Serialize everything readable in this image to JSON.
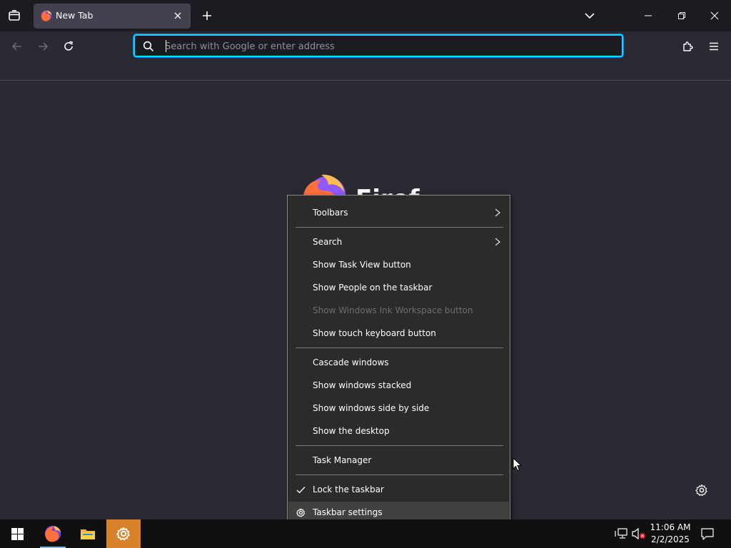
{
  "browser": {
    "tab": {
      "title": "New Tab"
    },
    "urlbar": {
      "placeholder": "Search with Google or enter address"
    },
    "content": {
      "wordmark": "Firef"
    }
  },
  "context_menu": {
    "items": [
      {
        "label": "Toolbars",
        "submenu": true,
        "disabled": false
      },
      {
        "label": "Search",
        "submenu": true,
        "disabled": false
      },
      {
        "label": "Show Task View button",
        "disabled": false
      },
      {
        "label": "Show People on the taskbar",
        "disabled": false
      },
      {
        "label": "Show Windows Ink Workspace button",
        "disabled": true
      },
      {
        "label": "Show touch keyboard button",
        "disabled": false
      },
      {
        "label": "Cascade windows",
        "disabled": false
      },
      {
        "label": "Show windows stacked",
        "disabled": false
      },
      {
        "label": "Show windows side by side",
        "disabled": false
      },
      {
        "label": "Show the desktop",
        "disabled": false
      },
      {
        "label": "Task Manager",
        "disabled": false
      },
      {
        "label": "Lock the taskbar",
        "checked": true,
        "disabled": false
      },
      {
        "label": "Taskbar settings",
        "icon": "gear-icon",
        "highlighted": true,
        "disabled": false
      }
    ]
  },
  "taskbar": {
    "clock": {
      "time": "11:06 AM",
      "date": "2/2/2025"
    }
  },
  "colors": {
    "accent": "#00ddff",
    "tab_bg": "#42414d",
    "menu_bg": "#2b2b2b",
    "settings_app_bg": "#d8832a"
  }
}
